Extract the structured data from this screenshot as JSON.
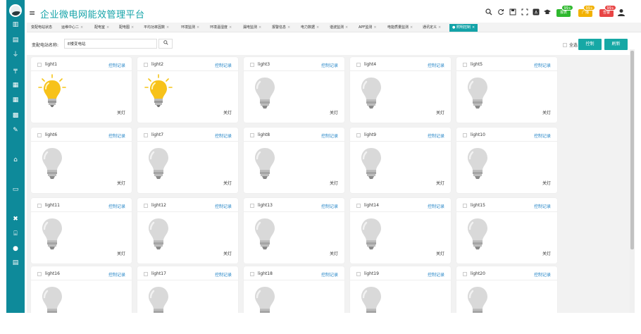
{
  "header": {
    "title": "企业微电网能效管理平台",
    "buttons": [
      {
        "label": "报表",
        "count": "99+",
        "color": "#2eb82e"
      },
      {
        "label": "广播",
        "count": "99+",
        "color": "#f2b100"
      },
      {
        "label": "告警",
        "count": "99+",
        "color": "#e84545"
      }
    ]
  },
  "tabs": [
    {
      "label": "变配电站状态",
      "active": false
    },
    {
      "label": "运维中心二",
      "active": false
    },
    {
      "label": "配电室",
      "active": false
    },
    {
      "label": "配电图",
      "active": false
    },
    {
      "label": "平均功率因数",
      "active": false
    },
    {
      "label": "环境监测",
      "active": false
    },
    {
      "label": "环境温湿度",
      "active": false
    },
    {
      "label": "漏电监测",
      "active": false
    },
    {
      "label": "报警信息",
      "active": false
    },
    {
      "label": "电力数据",
      "active": false
    },
    {
      "label": "谐波监测",
      "active": false
    },
    {
      "label": "APF监测",
      "active": false
    },
    {
      "label": "电能质量监测",
      "active": false
    },
    {
      "label": "通讯定义",
      "active": false
    },
    {
      "label": "● 照明控制",
      "active": true
    }
  ],
  "search": {
    "label": "变配电站名称:",
    "value": "E楼变电站"
  },
  "actions": {
    "select_all": "全选",
    "control": "控制",
    "refresh": "刷新"
  },
  "cards": [
    {
      "name": "light1",
      "record": "控制记录",
      "status": "关灯",
      "on": true
    },
    {
      "name": "light2",
      "record": "控制记录",
      "status": "关灯",
      "on": true
    },
    {
      "name": "light3",
      "record": "控制记录",
      "status": "关灯",
      "on": false
    },
    {
      "name": "light4",
      "record": "控制记录",
      "status": "关灯",
      "on": false
    },
    {
      "name": "light5",
      "record": "控制记录",
      "status": "关灯",
      "on": false
    },
    {
      "name": "light6",
      "record": "控制记录",
      "status": "关灯",
      "on": false
    },
    {
      "name": "light7",
      "record": "控制记录",
      "status": "关灯",
      "on": false
    },
    {
      "name": "light8",
      "record": "控制记录",
      "status": "关灯",
      "on": false
    },
    {
      "name": "light9",
      "record": "控制记录",
      "status": "关灯",
      "on": false
    },
    {
      "name": "light10",
      "record": "控制记录",
      "status": "关灯",
      "on": false
    },
    {
      "name": "light11",
      "record": "控制记录",
      "status": "关灯",
      "on": false
    },
    {
      "name": "light12",
      "record": "控制记录",
      "status": "关灯",
      "on": false
    },
    {
      "name": "light13",
      "record": "控制记录",
      "status": "关灯",
      "on": false
    },
    {
      "name": "light14",
      "record": "控制记录",
      "status": "关灯",
      "on": false
    },
    {
      "name": "light15",
      "record": "控制记录",
      "status": "关灯",
      "on": false
    },
    {
      "name": "light16",
      "record": "控制记录",
      "status": "",
      "on": false
    },
    {
      "name": "light17",
      "record": "控制记录",
      "status": "",
      "on": false
    },
    {
      "name": "light18",
      "record": "控制记录",
      "status": "",
      "on": false
    },
    {
      "name": "light19",
      "record": "控制记录",
      "status": "",
      "on": false
    },
    {
      "name": "light20",
      "record": "控制记录",
      "status": "",
      "on": false
    }
  ],
  "colors": {
    "accent": "#13a3a8",
    "sidebar": "#0e8a9a",
    "link": "#2a88c8",
    "bulb_on": "#f5c518",
    "bulb_off": "#d9d9d9"
  }
}
